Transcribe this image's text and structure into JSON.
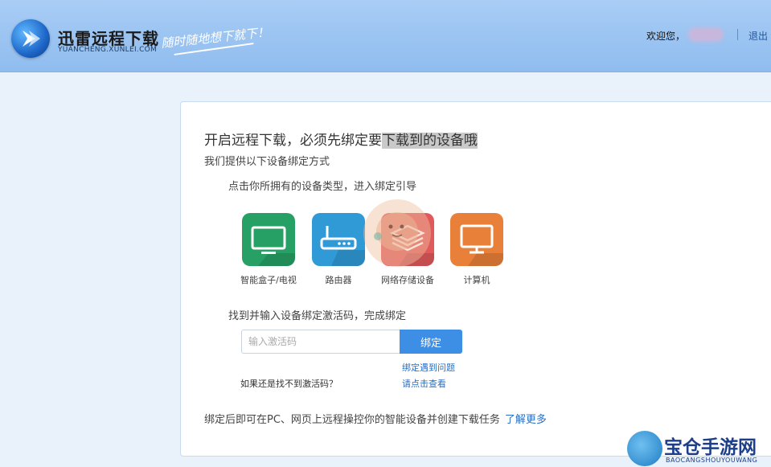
{
  "header": {
    "title": "迅雷远程下载",
    "subtitle": "YUANCHENG.XUNLEI.COM",
    "slogan": "随时随地想下就下！",
    "welcome": "欢迎您，",
    "logout": "退出"
  },
  "main": {
    "title_prefix": "开启远程下载，必须先绑定要",
    "title_highlight": "下载到的设备哦",
    "subtitle": "我们提供以下设备绑定方式",
    "step1": "点击你所拥有的设备类型，进入绑定引导",
    "devices": [
      {
        "label": "智能盒子/电视",
        "color": "#26a065",
        "icon": "tv-icon"
      },
      {
        "label": "路由器",
        "color": "#2f9ad6",
        "icon": "router-icon"
      },
      {
        "label": "网络存储设备",
        "color": "#e0595b",
        "icon": "storage-icon"
      },
      {
        "label": "计算机",
        "color": "#e9803a",
        "icon": "computer-icon"
      }
    ],
    "step2": "找到并输入设备绑定激活码，完成绑定",
    "input_placeholder": "输入激活码",
    "bind_button": "绑定",
    "problem_link": "绑定遇到问题",
    "no_code_text": "如果还是找不到激活码？",
    "check_link": "请点击查看",
    "footer_text": "绑定后即可在PC、网页上远程操控你的智能设备并创建下载任务",
    "learn_more": "了解更多"
  },
  "watermark": {
    "title": "宝仓手游网",
    "sub": "BAOCANGSHOUYOUWANG"
  }
}
